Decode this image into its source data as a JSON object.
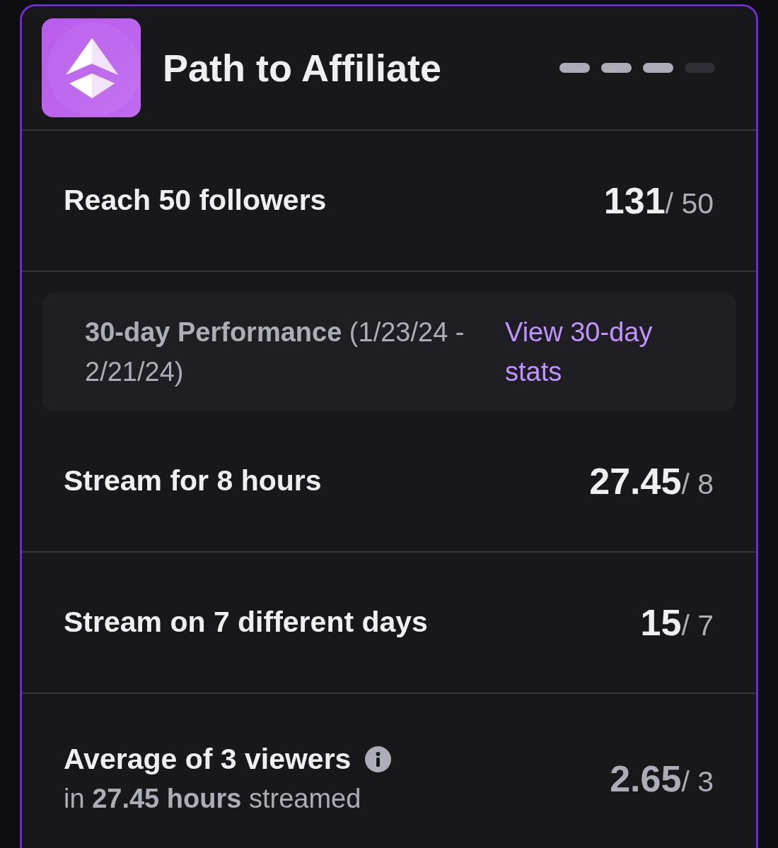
{
  "header": {
    "title": "Path to Affiliate"
  },
  "steps": [
    {
      "done": true
    },
    {
      "done": true
    },
    {
      "done": true
    },
    {
      "done": false
    }
  ],
  "items": [
    {
      "kind": "requirement",
      "label": "Reach 50 followers",
      "current": "131",
      "target": "/ 50",
      "met": true
    },
    {
      "kind": "performance",
      "summary": "**30-day Performance** (1/23/24 - 2/21/24)",
      "link": "View 30-day stats"
    },
    {
      "kind": "requirement",
      "label": "Stream for 8 hours",
      "current": "27.45",
      "target": "/ 8",
      "met": true
    },
    {
      "kind": "requirement",
      "label": "Stream on 7 different days",
      "current": "15",
      "target": "/ 7",
      "met": true
    },
    {
      "kind": "requirement",
      "label": "Average of 3 viewers",
      "info": true,
      "note": "in **27.45 hours** streamed",
      "current": "2.65",
      "target": "/ 3",
      "met": false
    }
  ]
}
